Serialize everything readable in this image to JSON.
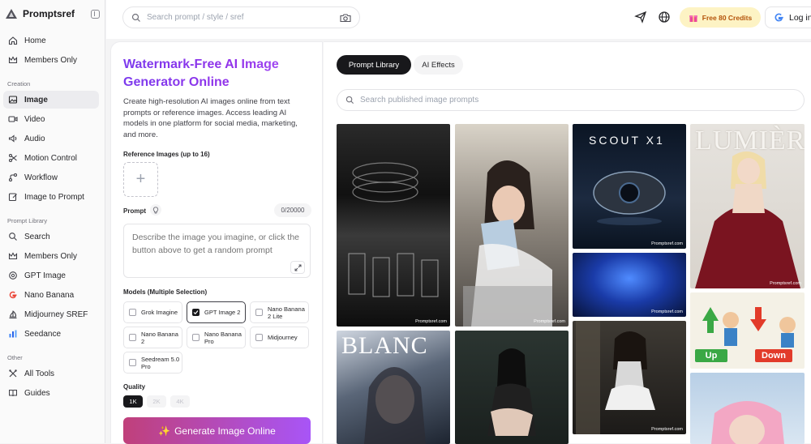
{
  "brand": {
    "name": "Promptsref"
  },
  "sidebar": {
    "top": [
      {
        "label": "Home",
        "icon": "home-icon"
      },
      {
        "label": "Members Only",
        "icon": "crown-icon"
      }
    ],
    "creation_label": "Creation",
    "creation": [
      {
        "label": "Image",
        "icon": "image-icon",
        "active": true
      },
      {
        "label": "Video",
        "icon": "video-icon"
      },
      {
        "label": "Audio",
        "icon": "audio-icon"
      },
      {
        "label": "Motion Control",
        "icon": "motion-icon"
      },
      {
        "label": "Workflow",
        "icon": "workflow-icon"
      },
      {
        "label": "Image to Prompt",
        "icon": "edit-icon"
      }
    ],
    "library_label": "Prompt Library",
    "library": [
      {
        "label": "Search",
        "icon": "search-icon"
      },
      {
        "label": "Members Only",
        "icon": "crown-icon"
      },
      {
        "label": "GPT Image",
        "icon": "gpt-icon"
      },
      {
        "label": "Nano Banana",
        "icon": "google-icon"
      },
      {
        "label": "Midjourney SREF",
        "icon": "midjourney-icon"
      },
      {
        "label": "Seedance",
        "icon": "seedance-icon"
      }
    ],
    "other_label": "Other",
    "other": [
      {
        "label": "All Tools",
        "icon": "tools-icon"
      },
      {
        "label": "Guides",
        "icon": "book-icon"
      }
    ]
  },
  "topbar": {
    "search_placeholder": "Search prompt / style / sref",
    "credits": "Free 80 Credits",
    "login": "Log in"
  },
  "generator": {
    "title": "Watermark-Free AI Image Generator Online",
    "description": "Create high-resolution AI images online from text prompts or reference images. Access leading AI models in one platform for social media, marketing, and more.",
    "reference_label": "Reference Images (up to 16)",
    "prompt_label": "Prompt",
    "prompt_counter": "0/20000",
    "prompt_placeholder": "Describe the image you imagine, or click the button above to get a random prompt",
    "models_label": "Models (Multiple Selection)",
    "models": [
      {
        "label": "Grok Imagine",
        "selected": false
      },
      {
        "label": "GPT Image 2",
        "selected": true
      },
      {
        "label": "Nano Banana 2 Lite",
        "selected": false
      },
      {
        "label": "Nano Banana 2",
        "selected": false
      },
      {
        "label": "Nano Banana Pro",
        "selected": false
      },
      {
        "label": "Midjourney",
        "selected": false
      },
      {
        "label": "Seedream 5.0 Pro",
        "selected": false
      }
    ],
    "quality_label": "Quality",
    "quality_options": [
      "1K",
      "2K",
      "4K"
    ],
    "quality_selected": "1K",
    "generate_label": "Generate Image Online",
    "generate_icon": "✨"
  },
  "gallery": {
    "tabs": [
      {
        "label": "Prompt Library",
        "active": true
      },
      {
        "label": "AI Effects",
        "active": false
      }
    ],
    "search_placeholder": "Search published image prompts",
    "watermark": "Promptsref.com",
    "tiles": [
      {
        "caption": ""
      },
      {
        "caption": ""
      },
      {
        "caption": "SCOUT X1"
      },
      {
        "caption": "LUMIÈRE"
      },
      {
        "caption": ""
      },
      {
        "caption": ""
      },
      {
        "caption": "BLANC"
      },
      {
        "caption": ""
      },
      {
        "caption": "Up"
      },
      {
        "caption": "Down"
      },
      {
        "caption": ""
      }
    ]
  }
}
